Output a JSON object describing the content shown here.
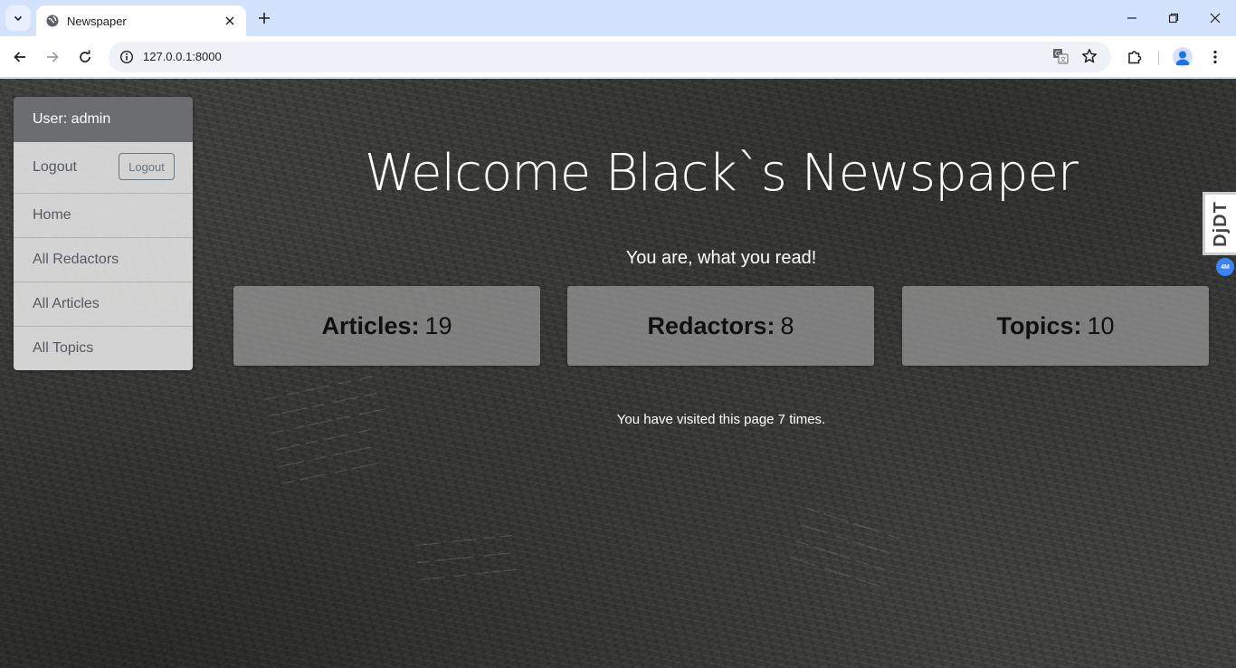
{
  "browser": {
    "tab_title": "Newspaper",
    "url": "127.0.0.1:8000"
  },
  "sidebar": {
    "user_label": "User: admin",
    "items": [
      {
        "label": "Logout",
        "button": "Logout"
      },
      {
        "label": "Home"
      },
      {
        "label": "All Redactors"
      },
      {
        "label": "All Articles"
      },
      {
        "label": "All Topics"
      }
    ]
  },
  "main": {
    "title": "Welcome Black`s Newspaper",
    "subtitle": "You are, what you read!",
    "stats": [
      {
        "label": "Articles:",
        "value": "19"
      },
      {
        "label": "Redactors:",
        "value": "8"
      },
      {
        "label": "Topics:",
        "value": "10"
      }
    ],
    "visits_text": "You have visited this page 7 times."
  },
  "debug_toolbar": {
    "handle_text": "DjDT",
    "badge_text": "4M"
  },
  "colors": {
    "tabstrip": "#d3e3fd",
    "sidebar_header": "#6b6d71",
    "card_bg": "#9b9b9b",
    "badge": "#3b82f6"
  }
}
